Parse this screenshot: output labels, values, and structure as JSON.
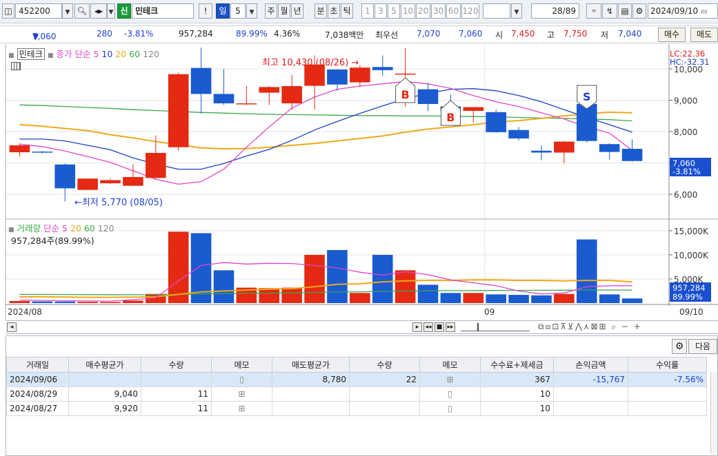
{
  "toolbar": {
    "code": "452200",
    "credit_badge": "신",
    "stock_name": "민테크",
    "alert_button": "!",
    "period_day": "일",
    "period_count": "5",
    "periods": [
      "주",
      "월",
      "년",
      "분",
      "초",
      "틱"
    ],
    "minute_options": [
      "1",
      "3",
      "5",
      "10",
      "20",
      "30",
      "60",
      "120"
    ],
    "page_counter": "28",
    "page_total": "/89",
    "date": "2024/09/10"
  },
  "info": {
    "price": "7,060",
    "down_arrow": "▼",
    "change": "280",
    "change_pct": "-3.81%",
    "volume": "957,284",
    "volume_ratio": "89.99%",
    "turnover": "4.36%",
    "amount": "7,038백만",
    "best_label": "최우선",
    "best_ask": "7,070",
    "best_bid": "7,060",
    "open_label": "시",
    "open": "7,450",
    "high_label": "고",
    "high": "7,750",
    "low_label": "저",
    "low": "7,040",
    "buy_button": "매수",
    "sell_button": "매도"
  },
  "legend": {
    "name": "민테크",
    "ma_label": "종가 단순",
    "ma_periods": [
      "5",
      "10",
      "20",
      "60",
      "120"
    ],
    "vol_title": "거래량",
    "vol_ma_label": "단순",
    "vol_ma_periods": [
      "5",
      "20",
      "60",
      "120"
    ],
    "vol_info": "957,284주(89.99%)"
  },
  "annotations": {
    "high": "최고 10,430 (08/26) →",
    "low": "←최저 5,770 (08/05)",
    "buy_marker": "B",
    "sell_marker": "S",
    "lc": "LC:22.36",
    "hc": "HC:-32.31",
    "price_tag": "7,060",
    "price_tag_pct": "-3.81%",
    "vol_tag": "957,284",
    "vol_tag_pct": "89.99%"
  },
  "axis": {
    "date_start": "2024/08",
    "date_mid": "09",
    "date_end": "09/10"
  },
  "colors": {
    "up": "#e42a13",
    "down": "#1a5bd0",
    "ma5": "#e046c8",
    "ma10": "#1e3fbf",
    "ma20": "#f0a818",
    "ma60": "#3aa84a",
    "vol_ma5": "#e046c8",
    "vol_ma20": "#f0a818",
    "vol_ma60": "#3aa84a"
  },
  "chart_data": {
    "type": "candlestick",
    "price_axis_ticks": [
      "10,000",
      "9,000",
      "8,000",
      "7,000",
      "6,000"
    ],
    "volume_axis_ticks": [
      "15,000K",
      "10,000K",
      "5,000K"
    ],
    "candles": [
      {
        "o": 7340,
        "h": 7620,
        "l": 7200,
        "c": 7560
      },
      {
        "o": 7360,
        "h": 7380,
        "l": 7300,
        "c": 7330
      },
      {
        "o": 6950,
        "h": 6980,
        "l": 5770,
        "c": 6190
      },
      {
        "o": 6140,
        "h": 6500,
        "l": 6130,
        "c": 6500
      },
      {
        "o": 6350,
        "h": 6500,
        "l": 6320,
        "c": 6450
      },
      {
        "o": 6270,
        "h": 6950,
        "l": 6260,
        "c": 6550
      },
      {
        "o": 6520,
        "h": 7880,
        "l": 6480,
        "c": 7320
      },
      {
        "o": 7500,
        "h": 9880,
        "l": 7380,
        "c": 9830
      },
      {
        "o": 10030,
        "h": 10680,
        "l": 8570,
        "c": 9200
      },
      {
        "o": 9200,
        "h": 10000,
        "l": 8850,
        "c": 8900
      },
      {
        "o": 8900,
        "h": 9460,
        "l": 8850,
        "c": 8900
      },
      {
        "o": 9240,
        "h": 9460,
        "l": 8850,
        "c": 9420
      },
      {
        "o": 8900,
        "h": 9810,
        "l": 8700,
        "c": 9450
      },
      {
        "o": 9460,
        "h": 10430,
        "l": 8700,
        "c": 10140
      },
      {
        "o": 9980,
        "h": 9980,
        "l": 9300,
        "c": 9500
      },
      {
        "o": 9570,
        "h": 10120,
        "l": 9420,
        "c": 10040
      },
      {
        "o": 10060,
        "h": 10430,
        "l": 9780,
        "c": 9960
      },
      {
        "o": 9850,
        "h": 10660,
        "l": 8800,
        "c": 9850
      },
      {
        "o": 9350,
        "h": 9550,
        "l": 8650,
        "c": 8880
      },
      {
        "o": 8800,
        "h": 9190,
        "l": 8410,
        "c": 8660
      },
      {
        "o": 8660,
        "h": 8770,
        "l": 8300,
        "c": 8780
      },
      {
        "o": 8620,
        "h": 8700,
        "l": 7960,
        "c": 7980
      },
      {
        "o": 8050,
        "h": 8150,
        "l": 7710,
        "c": 7780
      },
      {
        "o": 7390,
        "h": 7560,
        "l": 7080,
        "c": 7330
      },
      {
        "o": 7330,
        "h": 7700,
        "l": 6990,
        "c": 7680
      },
      {
        "o": 8880,
        "h": 9070,
        "l": 7650,
        "c": 7700
      },
      {
        "o": 7600,
        "h": 7620,
        "l": 7100,
        "c": 7350
      },
      {
        "o": 7450,
        "h": 7750,
        "l": 7040,
        "c": 7060
      }
    ],
    "ma5": [
      7600,
      7520,
      7380,
      7200,
      7020,
      6750,
      6480,
      6320,
      6400,
      6800,
      7500,
      8150,
      8750,
      9100,
      9350,
      9450,
      9520,
      9600,
      9520,
      9380,
      9150,
      8950,
      8800,
      8600,
      8400,
      8150,
      7950,
      7400
    ],
    "ma10": [
      7760,
      7760,
      7700,
      7560,
      7420,
      7160,
      6960,
      6800,
      6800,
      6980,
      7220,
      7430,
      7720,
      8050,
      8320,
      8580,
      8820,
      9050,
      9220,
      9350,
      9370,
      9300,
      9150,
      8950,
      8700,
      8450,
      8220,
      7980
    ],
    "ma20": [
      8220,
      8170,
      8100,
      8030,
      7900,
      7800,
      7680,
      7590,
      7480,
      7450,
      7460,
      7500,
      7560,
      7620,
      7700,
      7780,
      7860,
      7980,
      8080,
      8150,
      8220,
      8300,
      8350,
      8420,
      8500,
      8560,
      8620,
      8600
    ],
    "ma60": [
      8850,
      8830,
      8800,
      8770,
      8740,
      8700,
      8670,
      8640,
      8610,
      8590,
      8570,
      8550,
      8540,
      8530,
      8520,
      8510,
      8510,
      8500,
      8500,
      8490,
      8480,
      8470,
      8450,
      8430,
      8420,
      8400,
      8380,
      8340
    ],
    "volume": [
      420,
      350,
      330,
      260,
      230,
      520,
      1900,
      14800,
      14500,
      6800,
      3200,
      3100,
      3200,
      10000,
      11000,
      2100,
      10000,
      6800,
      3800,
      2100,
      2100,
      1800,
      1700,
      1600,
      1900,
      13200,
      1800,
      957
    ],
    "vol_ma5": [
      600,
      550,
      500,
      450,
      420,
      700,
      1100,
      4600,
      7800,
      8400,
      8100,
      8250,
      8200,
      7800,
      7300,
      6400,
      5800,
      6500,
      5900,
      4800,
      4200,
      3600,
      2500,
      1900,
      2100,
      3400,
      3600,
      3600
    ],
    "vol_ma20": [
      1300,
      1300,
      1250,
      1200,
      1200,
      1250,
      1300,
      1800,
      2300,
      2500,
      2700,
      2900,
      3000,
      3400,
      3900,
      4000,
      4400,
      4600,
      4700,
      4700,
      4800,
      4800,
      4700,
      4700,
      4600,
      4700,
      4700,
      4400
    ],
    "vol_ma60": [
      1800,
      1800,
      1780,
      1760,
      1740,
      1730,
      1730,
      1800,
      1900,
      1950,
      2000,
      2050,
      2100,
      2200,
      2300,
      2350,
      2450,
      2500,
      2550,
      2580,
      2600,
      2620,
      2640,
      2660,
      2670,
      2700,
      2720,
      2700
    ],
    "buy_signals": [
      17,
      19
    ],
    "sell_signals": [
      25
    ]
  },
  "bottom": {
    "next_button": "다음",
    "columns": [
      "거래일",
      "매수평균가",
      "수량",
      "메모",
      "매도평균가",
      "수량",
      "메모",
      "수수료+제세금",
      "손익금액",
      "수익률"
    ],
    "rows": [
      {
        "date": "2024/09/06",
        "buy_avg": "",
        "buy_qty": "",
        "buy_memo": "▯",
        "sell_avg": "8,780",
        "sell_qty": "22",
        "sell_memo": "⊞",
        "fee": "367",
        "pnl": "-15,767",
        "rate": "-7.56%"
      },
      {
        "date": "2024/08/29",
        "buy_avg": "9,040",
        "buy_qty": "11",
        "buy_memo": "⊞",
        "sell_avg": "",
        "sell_qty": "",
        "sell_memo": "▯",
        "fee": "10",
        "pnl": "",
        "rate": ""
      },
      {
        "date": "2024/08/27",
        "buy_avg": "9,920",
        "buy_qty": "11",
        "buy_memo": "⊞",
        "sell_avg": "",
        "sell_qty": "",
        "sell_memo": "▯",
        "fee": "10",
        "pnl": "",
        "rate": ""
      }
    ]
  }
}
